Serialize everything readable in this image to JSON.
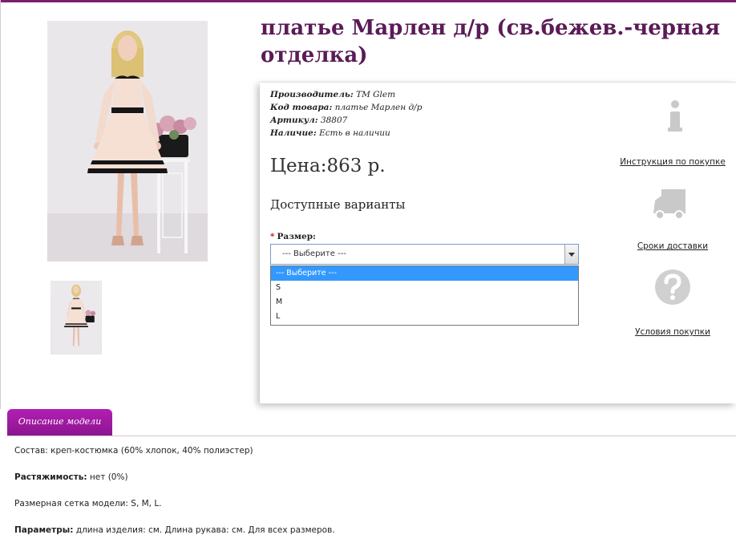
{
  "product": {
    "title": "платье Марлен д/р (св.бежев.-черная отделка)",
    "meta": [
      {
        "label": "Производитель:",
        "value": "TM Glem"
      },
      {
        "label": "Код товара:",
        "value": "платье Марлен д/р"
      },
      {
        "label": "Артикул:",
        "value": "38807"
      },
      {
        "label": "Наличие:",
        "value": "Есть в наличии"
      }
    ],
    "price": "Цена:863 р.",
    "variants_heading": "Доступные варианты",
    "size": {
      "label": "Размер:",
      "required_mark": "*",
      "selected": "--- Выберите ---",
      "options": [
        "--- Выберите ---",
        "S",
        "M",
        "L"
      ]
    }
  },
  "side_links": [
    {
      "label": "Инструкция по покупке",
      "icon": "info-icon"
    },
    {
      "label": "Сроки доставки",
      "icon": "truck-icon"
    },
    {
      "label": "Условия покупки",
      "icon": "question-icon"
    }
  ],
  "tabs": [
    {
      "label": "Описание модели"
    }
  ],
  "description": [
    {
      "label": "",
      "value": "Состав: креп-костюмка (60% хлопок, 40% полиэстер)"
    },
    {
      "label": "Растяжимость:",
      "value": " нет (0%)"
    },
    {
      "label": "",
      "value": "Размерная сетка модели: S, M, L."
    },
    {
      "label": "Параметры:",
      "value": " длина изделия: см. Длина рукава: см. Для всех размеров."
    }
  ],
  "colors": {
    "accent": "#5a1b57",
    "tab": "#a51aa6",
    "select_highlight": "#3399ff"
  }
}
